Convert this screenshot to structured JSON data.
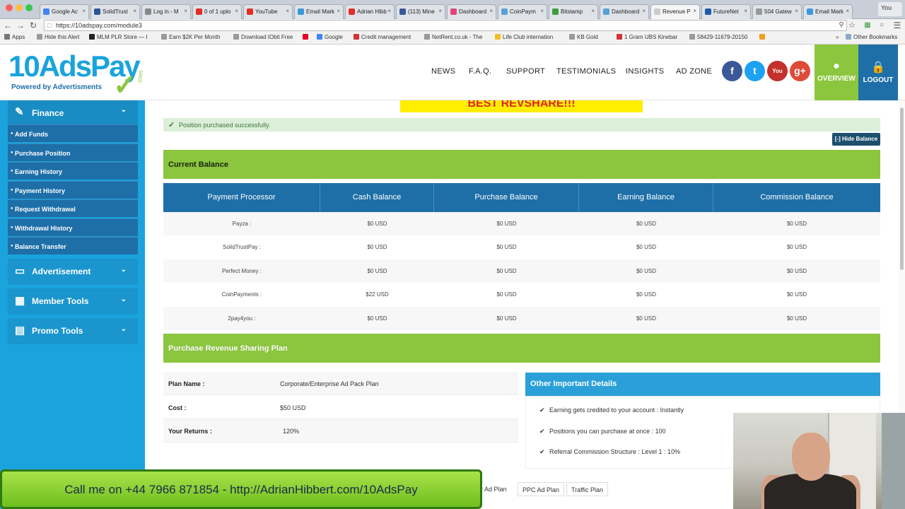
{
  "browser": {
    "tabs": [
      {
        "label": "Google Ac",
        "color": "#4285f4",
        "active": false
      },
      {
        "label": "SolidTrust",
        "color": "#2b5797",
        "active": false
      },
      {
        "label": "Log in - M",
        "color": "#888888",
        "active": false
      },
      {
        "label": "0 of 1 uplo",
        "color": "#e52d27",
        "active": false
      },
      {
        "label": "YouTube",
        "color": "#e52d27",
        "active": false
      },
      {
        "label": "Email Mark",
        "color": "#3a9ad9",
        "active": false
      },
      {
        "label": "Adrian Hibb",
        "color": "#e52d27",
        "active": false
      },
      {
        "label": "(113) Mine",
        "color": "#3b5998",
        "active": false
      },
      {
        "label": "Dashboard",
        "color": "#e0457b",
        "active": false
      },
      {
        "label": "CoinPaym",
        "color": "#5aa0d8",
        "active": false
      },
      {
        "label": "Bitstamp",
        "color": "#3f9b3f",
        "active": false
      },
      {
        "label": "Dashboard",
        "color": "#5aa0d8",
        "active": false
      },
      {
        "label": "Revenue P",
        "color": "#cccccc",
        "active": true
      },
      {
        "label": "FutureNet",
        "color": "#1e5aa8",
        "active": false
      },
      {
        "label": "504 Gatew",
        "color": "#999999",
        "active": false
      },
      {
        "label": "Email Mark",
        "color": "#3a9ad9",
        "active": false
      }
    ],
    "user_label": "You",
    "url": "https://10adspay.com/module3",
    "bookmarks": [
      {
        "label": "Apps",
        "color": "#777777"
      },
      {
        "label": "Hide this Alert",
        "color": "#999999"
      },
      {
        "label": "MLM PLR Store — I",
        "color": "#222222"
      },
      {
        "label": "Earn $2K Per Month",
        "color": "#999999"
      },
      {
        "label": "Download IObit Free",
        "color": "#999999"
      },
      {
        "label": "",
        "color": "#e60023"
      },
      {
        "label": "Google",
        "color": "#4285f4"
      },
      {
        "label": "Credit management",
        "color": "#d33333"
      },
      {
        "label": "NetRent.co.uk - The",
        "color": "#999999"
      },
      {
        "label": "Life Club internation",
        "color": "#f0c020"
      },
      {
        "label": "KB Gold",
        "color": "#999999"
      },
      {
        "label": "1 Gram UBS Kinebar",
        "color": "#d33333"
      },
      {
        "label": "58429-11679-20150",
        "color": "#999999"
      },
      {
        "label": "",
        "color": "#f0a020"
      }
    ],
    "other_bookmarks": "Other Bookmarks"
  },
  "header": {
    "logo_text": "10AdsPay",
    "logo_com": ".com",
    "logo_tagline": "Powered by Advertisments",
    "nav": [
      "NEWS",
      "F.A.Q.",
      "SUPPORT",
      "TESTIMONIALS",
      "INSIGHTS",
      "AD ZONE"
    ],
    "social": [
      {
        "name": "facebook-icon",
        "glyph": "f",
        "color": "#3b5998"
      },
      {
        "name": "twitter-icon",
        "glyph": "t",
        "color": "#1da1f2"
      },
      {
        "name": "youtube-icon",
        "glyph": "You",
        "color": "#c4302b"
      },
      {
        "name": "google-plus-icon",
        "glyph": "g+",
        "color": "#dd4b39"
      }
    ],
    "overview_label": "OVERVIEW",
    "logout_label": "LOGOUT",
    "overview_color": "#8cc63f",
    "logout_color": "#1e6fa8"
  },
  "sidebar": {
    "finance_label": "Finance",
    "finance_items": [
      "Add Funds",
      "Purchase Position",
      "Earning History",
      "Payment History",
      "Request Withdrawal",
      "Withdrawal History",
      "Balance Transfer"
    ],
    "groups": [
      "Advertisement",
      "Member Tools",
      "Promo Tools"
    ]
  },
  "main": {
    "banner_text": "BEST REVSHARE!!!",
    "alert_text": "Position purchased successfully.",
    "hide_balance_label": "[-] Hide Balance",
    "current_balance_title": "Current Balance",
    "balance_columns": [
      "Payment Processor",
      "Cash Balance",
      "Purchase Balance",
      "Earning Balance",
      "Commission Balance"
    ],
    "balance_rows": [
      [
        "Payza :",
        "$0 USD",
        "$0 USD",
        "$0 USD",
        "$0 USD"
      ],
      [
        "SolidTrustPay :",
        "$0 USD",
        "$0 USD",
        "$0 USD",
        "$0 USD"
      ],
      [
        "Perfect Money :",
        "$0 USD",
        "$0 USD",
        "$0 USD",
        "$0 USD"
      ],
      [
        "CoinPayments :",
        "$22 USD",
        "$0 USD",
        "$0 USD",
        "$0 USD"
      ],
      [
        "2pay4you :",
        "$0 USD",
        "$0 USD",
        "$0 USD",
        "$0 USD"
      ]
    ],
    "purchase_title": "Purchase Revenue Sharing Plan",
    "plan": [
      {
        "label": "Plan Name :",
        "value": "Corporate/Enterprise Ad Pack Plan"
      },
      {
        "label": "Cost :",
        "value": "$50 USD"
      },
      {
        "label": "Your Returns :",
        "value": "120%"
      }
    ],
    "details_title": "Other Important Details",
    "details": [
      "Earning gets credited to your account : Instantly",
      "Positions you can purchase at once : 100",
      "Referral Commission Structure : Level 1 : 10%"
    ],
    "plan_tabs": [
      "r Ad Plan",
      "PPC Ad Plan",
      "Traffic Plan"
    ]
  },
  "overlay": {
    "call_text": "Call me on +44 7966 871854 - http://AdrianHibbert.com/10AdsPay"
  }
}
